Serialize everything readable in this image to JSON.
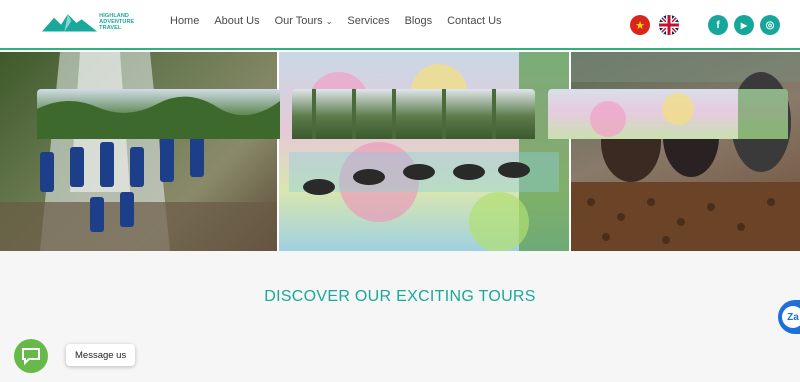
{
  "brand": {
    "logo_line1": "HIGHLAND",
    "logo_line2": "ADVENTURE TRAVEL"
  },
  "nav": {
    "items": [
      {
        "label": "Home"
      },
      {
        "label": "About Us"
      },
      {
        "label": "Our Tours",
        "has_dropdown": true
      },
      {
        "label": "Services"
      },
      {
        "label": "Blogs"
      },
      {
        "label": "Contact Us"
      }
    ]
  },
  "lang": {
    "vn_symbol": "★"
  },
  "social": {
    "facebook": "f",
    "youtube": "▶",
    "instagram": "◎"
  },
  "section": {
    "title": "DISCOVER OUR EXCITING TOURS"
  },
  "chat": {
    "label": "Message us"
  },
  "zalo": {
    "label": "Za"
  },
  "colors": {
    "accent": "#19a89c",
    "header_border": "#2db37a",
    "chat_green": "#67b94a",
    "zalo_blue": "#1e6fd9"
  }
}
